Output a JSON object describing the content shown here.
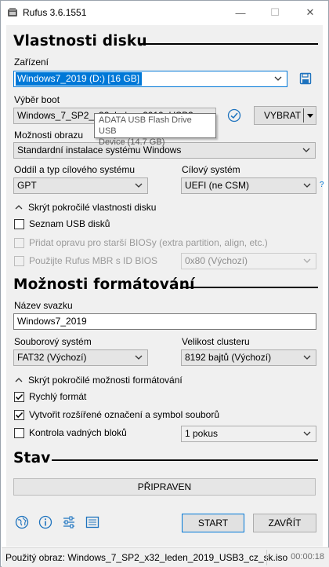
{
  "window": {
    "title": "Rufus 3.6.1551",
    "minimize_glyph": "—",
    "maximize_glyph": "☐",
    "close_glyph": "✕"
  },
  "drive_properties": {
    "section_title": "Vlastnosti disku",
    "device_label": "Zařízení",
    "device_value": "Windows7_2019 (D:) [16 GB]",
    "boot_label": "Výběr boot",
    "boot_value": "Windows_7_SP2_x32_leden_2019_USB3_cz_sk",
    "select_button": "VYBRAT",
    "image_option_label": "Možnosti obrazu",
    "image_option_value": "Standardní instalace systému Windows",
    "partition_label": "Oddíl a typ cílového systému",
    "partition_value": "GPT",
    "target_label": "Cílový systém",
    "target_value": "UEFI (ne CSM)",
    "help_mark": "?",
    "tooltip_line1": "ADATA USB Flash Drive USB",
    "tooltip_line2": "Device (14.7 GB)",
    "advanced_toggle": "Skrýt pokročilé vlastnosti disku",
    "list_usb": "Seznam USB disků",
    "add_fixes": "Přidat opravu pro starší BIOSy (extra partition, align, etc.)",
    "use_mbr": "Použijte Rufus MBR s ID BIOS",
    "bios_id_value": "0x80 (Výchozí)"
  },
  "format_options": {
    "section_title": "Možnosti formátování",
    "volume_label": "Název svazku",
    "volume_value": "Windows7_2019",
    "fs_label": "Souborový systém",
    "fs_value": "FAT32 (Výchozí)",
    "cluster_label": "Velikost clusteru",
    "cluster_value": "8192 bajtů (Výchozí)",
    "advanced_toggle": "Skrýt pokročilé možnosti formátování",
    "quick_format": "Rychlý formát",
    "extended_label": "Vytvořit rozšířené označení a symbol souborů",
    "bad_blocks": "Kontrola vadných bloků",
    "passes_value": "1 pokus"
  },
  "status": {
    "section_title": "Stav",
    "progress_text": "PŘIPRAVEN",
    "start_button": "START",
    "close_button": "ZAVŘÍT"
  },
  "statusbar": {
    "image_text": "Použitý obraz: Windows_7_SP2_x32_leden_2019_USB3_cz_sk.iso",
    "elapsed": "00:00:18"
  },
  "colors": {
    "accent": "#0078d7",
    "check_icon": "#1e73be"
  }
}
